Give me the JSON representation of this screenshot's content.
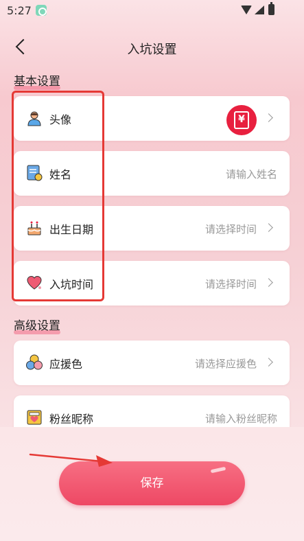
{
  "status_bar": {
    "time": "5:27"
  },
  "header": {
    "title": "入坑设置"
  },
  "sections": {
    "basic": {
      "title": "基本设置"
    },
    "advanced": {
      "title": "高级设置"
    }
  },
  "items": {
    "avatar": {
      "label": "头像"
    },
    "name": {
      "label": "姓名",
      "placeholder": "请输入姓名"
    },
    "birthday": {
      "label": "出生日期",
      "placeholder": "请选择时间"
    },
    "entry_time": {
      "label": "入坑时间",
      "placeholder": "请选择时间"
    },
    "support_color": {
      "label": "应援色",
      "placeholder": "请选择应援色"
    },
    "fan_nickname": {
      "label": "粉丝昵称",
      "placeholder": "请输入粉丝昵称"
    }
  },
  "save_button": {
    "label": "保存"
  },
  "colors": {
    "accent": "#ee4864",
    "annotation": "#e53935"
  }
}
